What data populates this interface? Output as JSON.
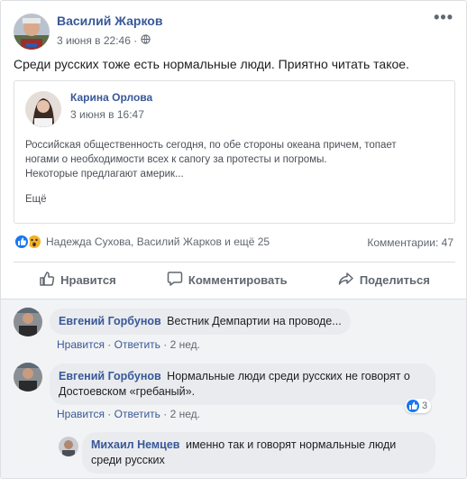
{
  "post": {
    "author": "Василий Жарков",
    "timestamp": "3 июня в 22:46 ·",
    "privacy_icon": "globe-icon",
    "more_label": "•••",
    "text": "Среди русских тоже есть нормальные люди. Приятно читать такое."
  },
  "shared": {
    "author": "Карина Орлова",
    "timestamp": "3 июня в 16:47",
    "body_line1": "Российская общественность сегодня, по обе стороны океана причем, топает",
    "body_line2": "ногами о необходимости всех к сапогу за протесты и погромы.",
    "body_line3": "Некоторые предлагают америк...",
    "see_more": "Ещё"
  },
  "reactions": {
    "names": "Надежда Сухова, Василий Жарков и ещё 25",
    "comments": "Комментарии: 47",
    "icons": [
      "like-icon",
      "wow-icon"
    ],
    "colors": {
      "like": "#1877f2",
      "wow": "#f7b125"
    }
  },
  "actions": {
    "like": "Нравится",
    "comment": "Комментировать",
    "share": "Поделиться"
  },
  "comments": [
    {
      "author": "Евгений Горбунов",
      "text": "Вестник Демпартии на проводе...",
      "like": "Нравится",
      "reply": "Ответить",
      "time": "2 нед."
    },
    {
      "author": "Евгений Горбунов",
      "text_line1": "Нормальные люди среди русских не говорят о",
      "text_line2": "Достоевском «гребаный».",
      "like": "Нравится",
      "reply": "Ответить",
      "time": "2 нед.",
      "likes_count": "3"
    },
    {
      "author": "Михаил Немцев",
      "text_line1": "именно так и говорят нормальные люди",
      "text_line2": "среди русских"
    }
  ],
  "separator": "·"
}
